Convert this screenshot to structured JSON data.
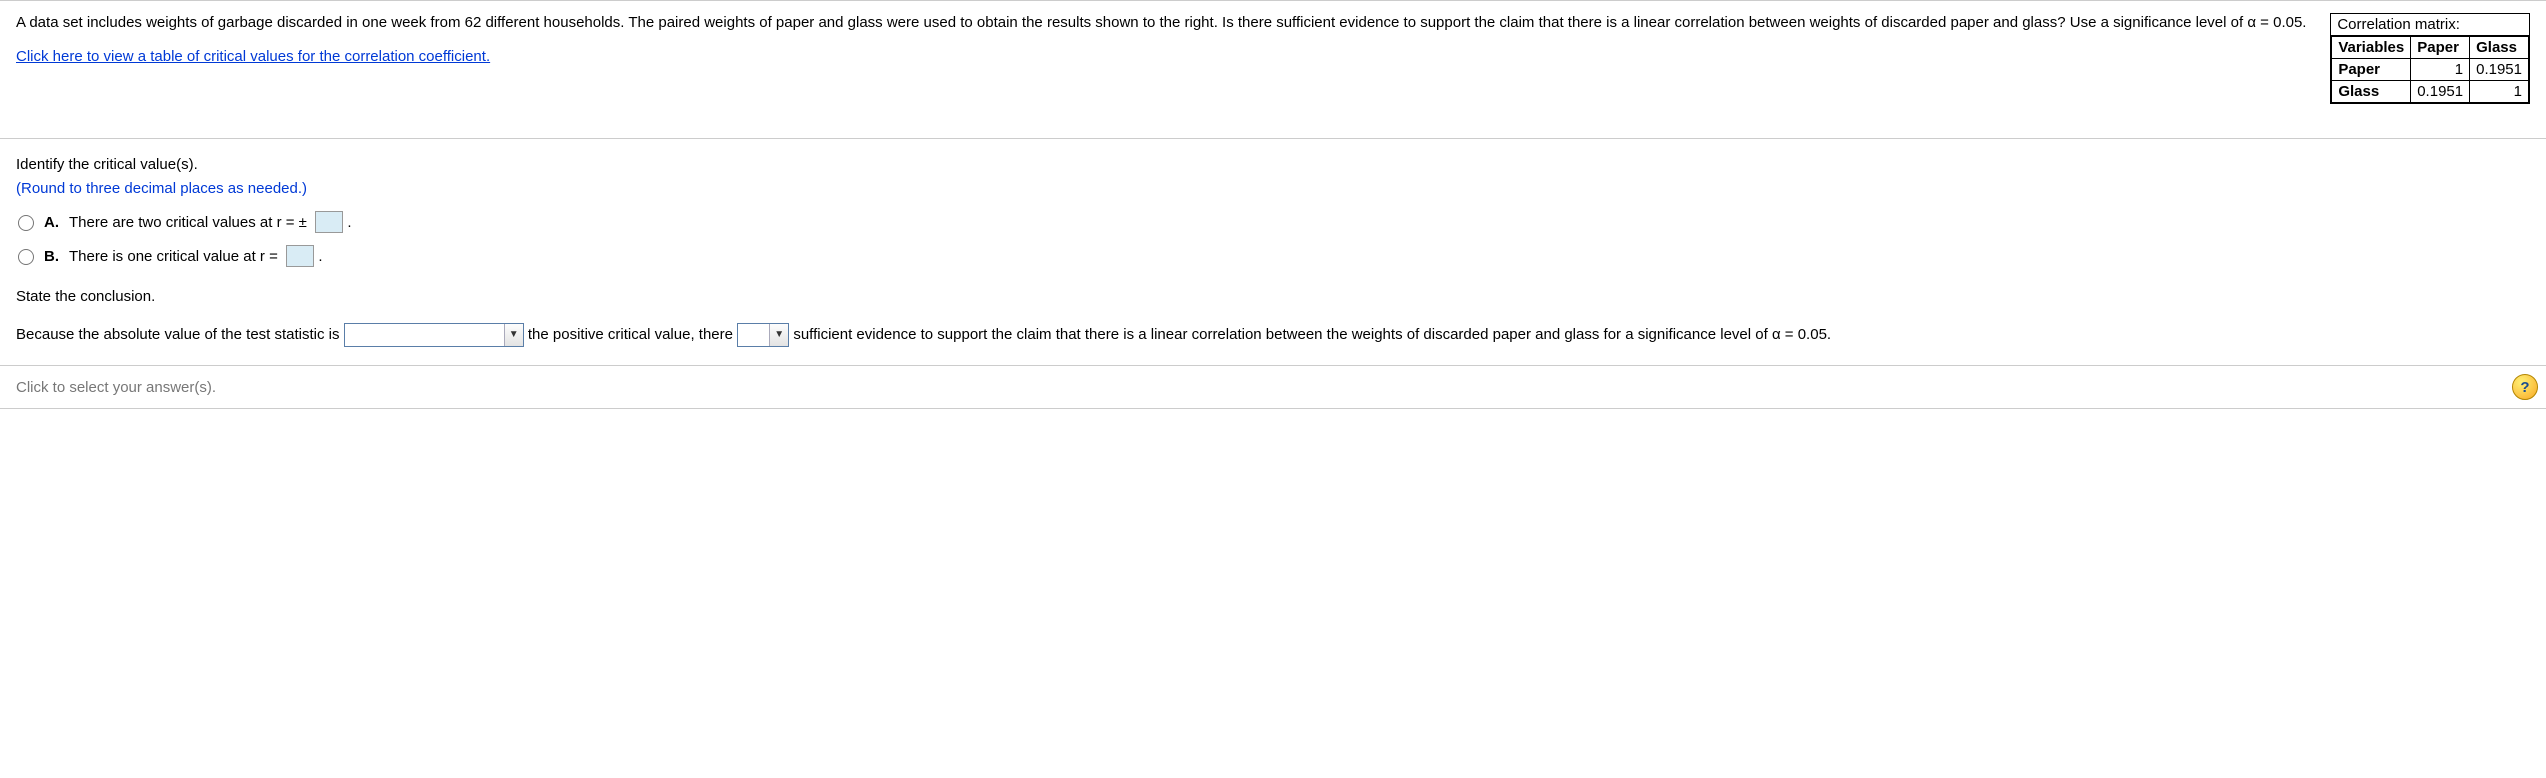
{
  "problem": {
    "main": "A data set includes weights of garbage discarded in one week from 62 different households. The paired weights of paper and glass were used to obtain the results shown to the right. Is there sufficient evidence to support the claim that there is a linear correlation between weights of discarded paper and glass? Use a significance level of α = 0.05.",
    "link": "Click here to view a table of critical values for the correlation coefficient."
  },
  "matrix": {
    "title": "Correlation matrix:",
    "headers": {
      "variables": "Variables",
      "col1": "Paper",
      "col2": "Glass"
    },
    "rows": [
      {
        "label": "Paper",
        "c1": "1",
        "c2": "0.1951"
      },
      {
        "label": "Glass",
        "c1": "0.1951",
        "c2": "1"
      }
    ]
  },
  "q1": {
    "prompt": "Identify the critical value(s).",
    "note": "(Round to three decimal places as needed.)",
    "optA": {
      "letter": "A.",
      "before": "There are two critical values at r = ±",
      "after": "."
    },
    "optB": {
      "letter": "B.",
      "before": "There is one critical value at r =",
      "after": "."
    }
  },
  "q2": {
    "prompt": "State the conclusion.",
    "seg1": "Because the absolute value of the test statistic is",
    "seg2": "the positive critical value, there",
    "seg3": "sufficient evidence to support the claim that there is a linear correlation between the weights of discarded paper and glass for a significance level of α = 0.05."
  },
  "footer": {
    "hint": "Click to select your answer(s).",
    "help": "?"
  }
}
